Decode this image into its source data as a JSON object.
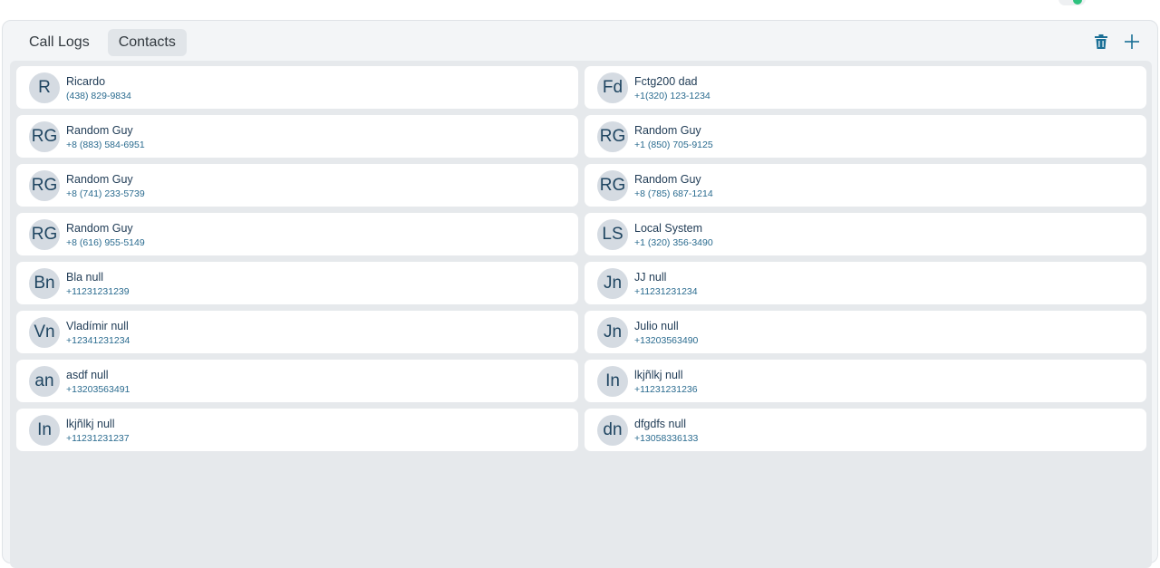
{
  "tabs": [
    {
      "label": "Call Logs",
      "active": false
    },
    {
      "label": "Contacts",
      "active": true
    }
  ],
  "actions": {
    "delete_icon": "trash-icon",
    "add_icon": "plus-icon"
  },
  "colors": {
    "accent": "#1a6f96",
    "toggle_on": "#2ec27e"
  },
  "contacts": [
    {
      "initials": "R",
      "name": "Ricardo",
      "phone": "(438) 829-9834"
    },
    {
      "initials": "Fd",
      "name": "Fctg200 dad",
      "phone": "+1(320) 123-1234"
    },
    {
      "initials": "RG",
      "name": "Random Guy",
      "phone": "+8 (883) 584-6951"
    },
    {
      "initials": "RG",
      "name": "Random Guy",
      "phone": "+1 (850) 705-9125"
    },
    {
      "initials": "RG",
      "name": "Random Guy",
      "phone": "+8 (741) 233-5739"
    },
    {
      "initials": "RG",
      "name": "Random Guy",
      "phone": "+8 (785) 687-1214"
    },
    {
      "initials": "RG",
      "name": "Random Guy",
      "phone": "+8 (616) 955-5149"
    },
    {
      "initials": "LS",
      "name": "Local System",
      "phone": "+1 (320) 356-3490"
    },
    {
      "initials": "Bn",
      "name": "Bla null",
      "phone": "+11231231239"
    },
    {
      "initials": "Jn",
      "name": "JJ null",
      "phone": "+11231231234"
    },
    {
      "initials": "Vn",
      "name": "Vladímir null",
      "phone": "+12341231234"
    },
    {
      "initials": "Jn",
      "name": "Julio null",
      "phone": "+13203563490"
    },
    {
      "initials": "an",
      "name": "asdf null",
      "phone": "+13203563491"
    },
    {
      "initials": "In",
      "name": "lkjñlkj null",
      "phone": "+11231231236"
    },
    {
      "initials": "In",
      "name": "lkjñlkj null",
      "phone": "+11231231237"
    },
    {
      "initials": "dn",
      "name": "dfgdfs null",
      "phone": "+13058336133"
    }
  ]
}
